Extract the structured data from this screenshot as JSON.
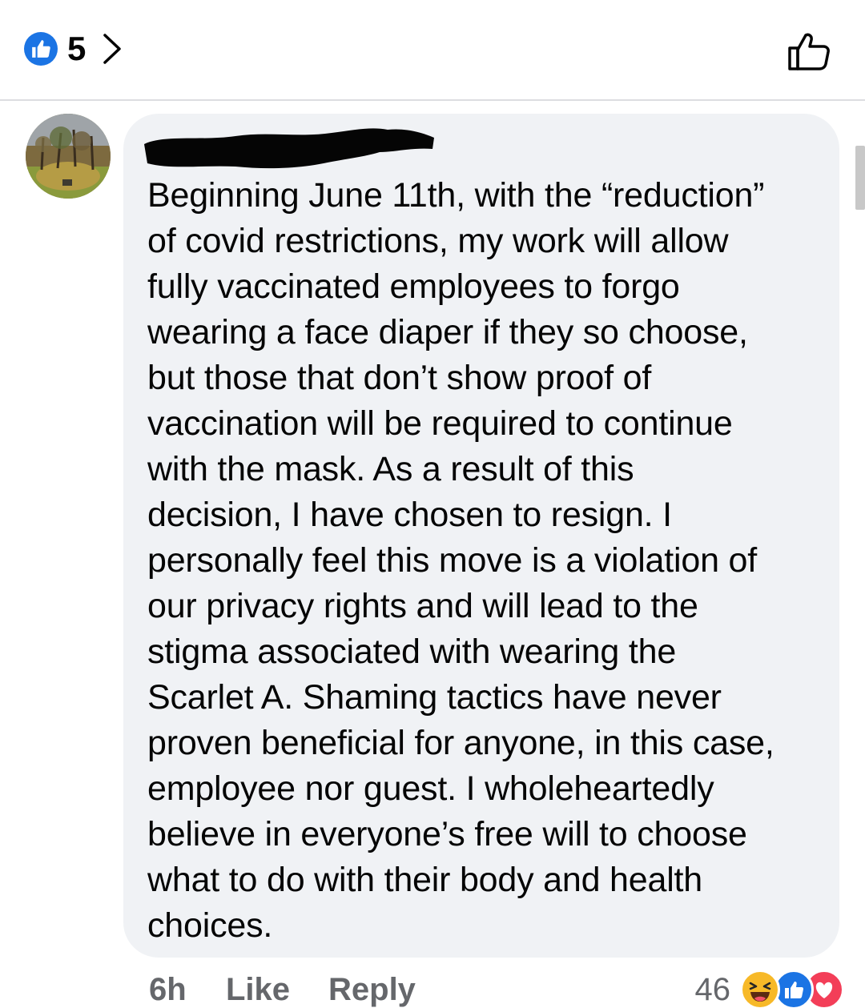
{
  "header": {
    "reaction_count": "5",
    "reaction_icon": "like-thumb-icon",
    "chevron_icon": "chevron-right-icon",
    "like_button_icon": "thumbs-up-outline-icon"
  },
  "comment": {
    "author_redacted": true,
    "text": "Beginning June 11th, with the “reduction”\nof covid restrictions, my work will allow\nfully vaccinated employees to forgo\nwearing a face diaper if they so choose,\nbut those that don’t show proof of\nvaccination will be required to continue\nwith the mask. As a result of this\ndecision, I have chosen to resign. I\npersonally feel this move is a violation of\nour privacy rights and will lead to the\nstigma associated with wearing the\nScarlet A. Shaming tactics have never\nproven beneficial for anyone, in this case,\nemployee nor guest. I wholeheartedly\nbelieve in everyone’s free will to choose\nwhat to do with their body and health\nchoices."
  },
  "actions": {
    "time": "6h",
    "like": "Like",
    "reply": "Reply"
  },
  "reactions": {
    "count": "46",
    "icons": [
      "haha-icon",
      "like-icon",
      "love-icon"
    ]
  },
  "colors": {
    "like_blue": "#1b74e4",
    "love_red": "#f33e58",
    "haha_yellow": "#f7b928",
    "bubble_bg": "#f0f2f5",
    "meta_gray": "#65676b"
  }
}
